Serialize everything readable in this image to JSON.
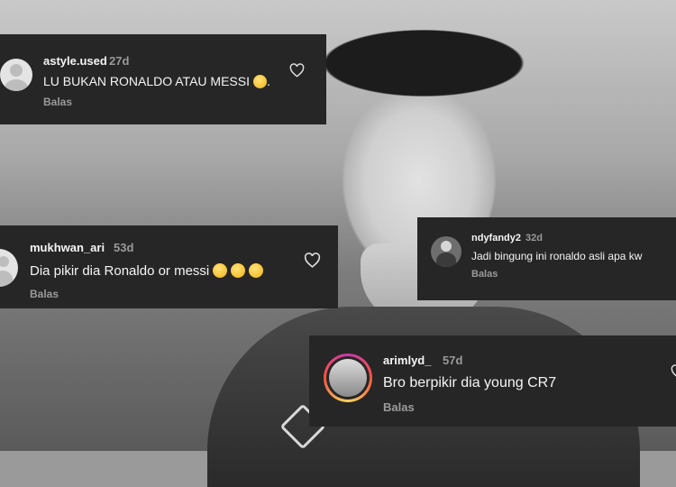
{
  "comments": [
    {
      "username": "astyle.used",
      "age": "27d",
      "text": "LU BUKAN RONALDO ATAU MESSI",
      "text_suffix": ".",
      "emojis": [
        "worried-face-emoji"
      ],
      "reply_label": "Balas"
    },
    {
      "username": "mukhwan_ari",
      "age": "53d",
      "text": "Dia pikir dia Ronaldo or messi",
      "emojis": [
        "smirk-face-emoji",
        "laughing-crying-face-emoji",
        "laughing-crying-face-emoji"
      ],
      "reply_label": "Balas"
    },
    {
      "username": "ndyfandy2",
      "age": "32d",
      "text": "Jadi bingung ini ronaldo asli apa kw",
      "reply_label": "Balas"
    },
    {
      "username": "arimlyd_",
      "age": "57d",
      "text": "Bro berpikir dia young CR7",
      "reply_label": "Balas"
    }
  ],
  "icons": {
    "like": "heart-outline-icon",
    "default_avatar": "default-avatar-icon"
  },
  "colors": {
    "card_background": "#262626",
    "text_primary": "#f5f5f5",
    "text_secondary": "#9a9a9a"
  }
}
